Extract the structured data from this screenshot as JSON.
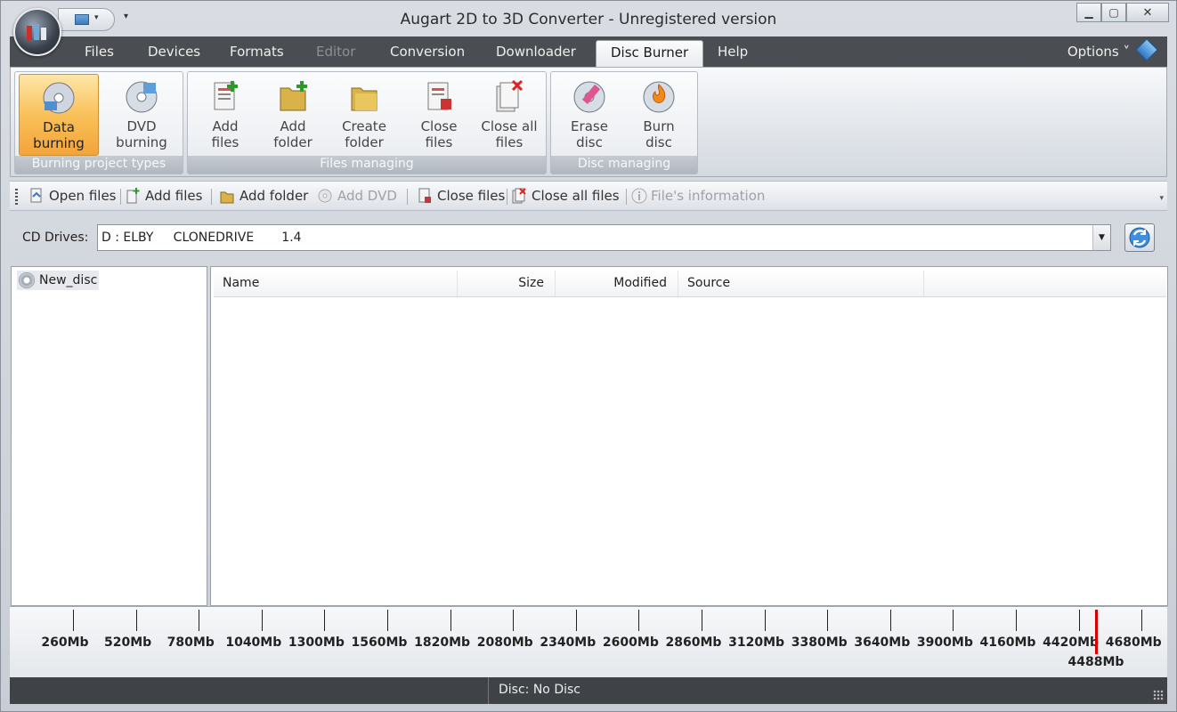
{
  "window": {
    "title": "Augart 2D to 3D Converter - Unregistered version",
    "minimize_glyph": "▁",
    "maximize_glyph": "▢",
    "close_glyph": "✕",
    "qat_dropdown": "▾",
    "qat_more": "▾"
  },
  "menu": {
    "tabs": [
      {
        "label": "Files"
      },
      {
        "label": "Devices"
      },
      {
        "label": "Formats"
      },
      {
        "label": "Editor"
      },
      {
        "label": "Conversion"
      },
      {
        "label": "Downloader"
      },
      {
        "label": "Disc Burner"
      },
      {
        "label": "Help"
      }
    ],
    "options_label": "Options ˅"
  },
  "ribbon": {
    "groups": [
      {
        "label": "Burning project types"
      },
      {
        "label": "Files managing"
      },
      {
        "label": "Disc managing"
      }
    ],
    "buttons": [
      {
        "line1": "Data",
        "line2": "burning"
      },
      {
        "line1": "DVD",
        "line2": "burning"
      },
      {
        "line1": "Add",
        "line2": "files"
      },
      {
        "line1": "Add",
        "line2": "folder"
      },
      {
        "line1": "Create",
        "line2": "folder"
      },
      {
        "line1": "Close",
        "line2": "files"
      },
      {
        "line1": "Close all",
        "line2": "files"
      },
      {
        "line1": "Erase",
        "line2": "disc"
      },
      {
        "line1": "Burn",
        "line2": "disc"
      }
    ]
  },
  "toolbar": {
    "items": [
      {
        "label": "Open files"
      },
      {
        "label": "Add files"
      },
      {
        "label": "Add folder"
      },
      {
        "label": "Add DVD"
      },
      {
        "label": "Close files"
      },
      {
        "label": "Close all files"
      },
      {
        "label": "File's information"
      }
    ],
    "more_glyph": "▾"
  },
  "cd_drives": {
    "label": "CD Drives:",
    "value": "D : ELBY     CLONEDRIVE       1.4",
    "dropdown_glyph": "▼"
  },
  "tree": {
    "root": "New_disc"
  },
  "filelist": {
    "columns": [
      "Name",
      "Size",
      "Modified",
      "Source"
    ]
  },
  "ruler": {
    "ticks": [
      "260Mb",
      "520Mb",
      "780Mb",
      "1040Mb",
      "1300Mb",
      "1560Mb",
      "1820Mb",
      "2080Mb",
      "2340Mb",
      "2600Mb",
      "2860Mb",
      "3120Mb",
      "3380Mb",
      "3640Mb",
      "3900Mb",
      "4160Mb",
      "4420Mb",
      "4680Mb"
    ],
    "marker_label": "4488Mb",
    "marker_color": "#d60000"
  },
  "status": {
    "text": "Disc: No Disc"
  }
}
